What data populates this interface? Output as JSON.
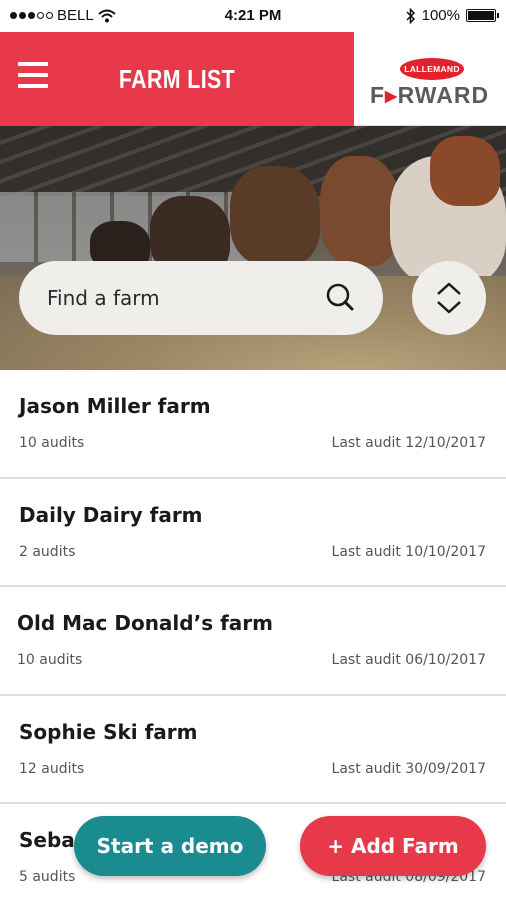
{
  "status_bar": {
    "carrier": "BELL",
    "time": "4:21 PM",
    "battery": "100%",
    "battery_level": 1.0
  },
  "header": {
    "title": "FARM LIST",
    "logo_badge": "LALLEMAND",
    "logo_word_part1": "F",
    "logo_word_part2": "RWARD",
    "menu_icon": "hamburger-menu-icon"
  },
  "search": {
    "placeholder": "Find a farm",
    "icon": "search-icon",
    "sort_icon": "sort-up-down-icon"
  },
  "farms": [
    {
      "name": "Jason Miller farm",
      "audits": "10 audits",
      "last_audit": "Last audit 12/10/2017"
    },
    {
      "name": "Daily Dairy farm",
      "audits": "2 audits",
      "last_audit": "Last audit 10/10/2017"
    },
    {
      "name": "Old Mac Donald’s farm",
      "audits": "10 audits",
      "last_audit": "Last audit 06/10/2017"
    },
    {
      "name": "Sophie Ski farm",
      "audits": "12 audits",
      "last_audit": "Last audit 30/09/2017"
    },
    {
      "name": "Sebastian Dairy farm",
      "audits": "5 audits",
      "last_audit": "Last audit 08/09/2017"
    }
  ],
  "actions": {
    "demo_label": "Start a demo",
    "add_label": "+ Add Farm"
  },
  "colors": {
    "header_red": "#e8394b",
    "demo_teal": "#1a8c8f",
    "add_red": "#e8394b",
    "logo_red": "#e2232e"
  }
}
